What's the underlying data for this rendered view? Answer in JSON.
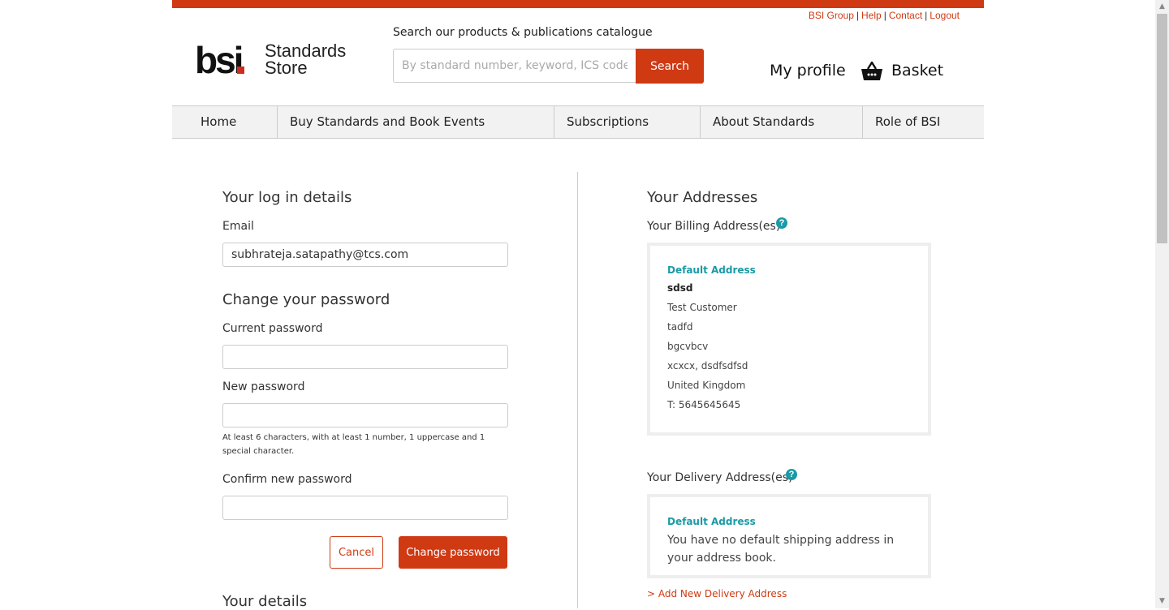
{
  "util_links": [
    "BSI Group",
    "Help",
    "Contact",
    "Logout"
  ],
  "logo": {
    "mark": "bsi",
    "line1": "Standards",
    "line2": "Store"
  },
  "search": {
    "label": "Search our products & publications catalogue",
    "placeholder": "By standard number, keyword, ICS code, ISBN",
    "button": "Search"
  },
  "header": {
    "profile": "My profile",
    "basket": "Basket"
  },
  "nav": [
    "Home",
    "Buy Standards and Book Events",
    "Subscriptions",
    "About Standards",
    "Role of BSI"
  ],
  "login": {
    "title": "Your log in details",
    "email_label": "Email",
    "email_value": "subhrateja.satapathy@tcs.com"
  },
  "password": {
    "title": "Change your password",
    "current_label": "Current password",
    "new_label": "New password",
    "hint": "At least 6 characters, with at least 1 number, 1 uppercase and 1 special character.",
    "confirm_label": "Confirm new password",
    "cancel": "Cancel",
    "submit": "Change password"
  },
  "details": {
    "title": "Your details"
  },
  "addresses": {
    "title": "Your Addresses",
    "billing_label": "Your Billing Address(es)",
    "billing": {
      "heading": "Default Address",
      "lines": [
        "sdsd",
        "Test Customer",
        "tadfd",
        "bgcvbcv",
        "xcxcx, dsdfsdfsd",
        "United Kingdom",
        "T: 5645645645"
      ]
    },
    "delivery_label": "Your Delivery Address(es)",
    "delivery": {
      "heading": "Default Address",
      "text": "You have no default shipping address in your address book."
    },
    "add_link": "> Add New Delivery Address"
  },
  "help_glyph": "?",
  "colors": {
    "brand": "#cf3a13",
    "accent": "#1a9aa6"
  }
}
